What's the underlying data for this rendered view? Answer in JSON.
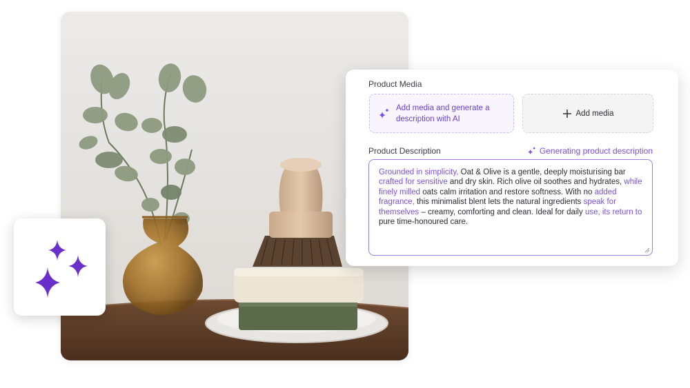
{
  "product_media": {
    "label": "Product Media",
    "ai_button_label": "Add media and generate a description with AI",
    "add_media_label": "Add media",
    "add_media_icon": "plus-icon",
    "ai_button_icon": "sparkles-icon"
  },
  "product_description": {
    "label": "Product Description",
    "status": "Generating product description",
    "status_icon": "sparkles-icon",
    "segments": [
      {
        "text": "Grounded in simplicity, ",
        "ai": true
      },
      {
        "text": "Oat & Olive is a gentle, deeply moisturising bar ",
        "ai": false
      },
      {
        "text": "crafted for sensitive ",
        "ai": true
      },
      {
        "text": "and dry skin. Rich olive oil soothes and hydrates, ",
        "ai": false
      },
      {
        "text": "while finely milled ",
        "ai": true
      },
      {
        "text": "oats calm irritation and restore softness. With no ",
        "ai": false
      },
      {
        "text": "added fragrance, ",
        "ai": true
      },
      {
        "text": "this minimalist blent lets the natural ingredients ",
        "ai": false
      },
      {
        "text": "speak for themselves ",
        "ai": true
      },
      {
        "text": "– creamy, comforting and clean. Ideal for daily ",
        "ai": false
      },
      {
        "text": "use, its return to ",
        "ai": true
      },
      {
        "text": "pure time-honoured care.",
        "ai": false
      }
    ]
  },
  "colors": {
    "accent": "#7a4fe0",
    "sparkle_tile": "#6a2ecb"
  }
}
